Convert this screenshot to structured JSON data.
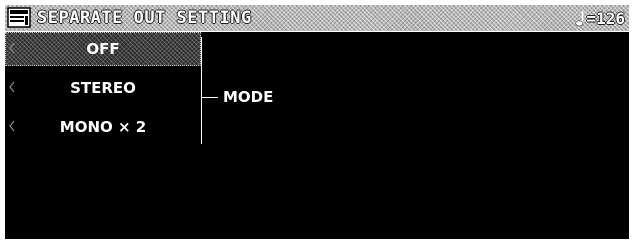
{
  "header": {
    "title": "SEPARATE OUT SETTING",
    "icon": "panel-icon",
    "tempo_icon": "quarter-note-icon",
    "tempo_value": "=126"
  },
  "options": {
    "items": [
      {
        "label": "OFF",
        "selected": true
      },
      {
        "label": "STEREO",
        "selected": false
      },
      {
        "label": "MONO × 2",
        "selected": false
      }
    ]
  },
  "parameter": {
    "label": "MODE"
  },
  "colors": {
    "background": "#000000",
    "text": "#ffffff",
    "titlebar": "#b8b8b8"
  }
}
